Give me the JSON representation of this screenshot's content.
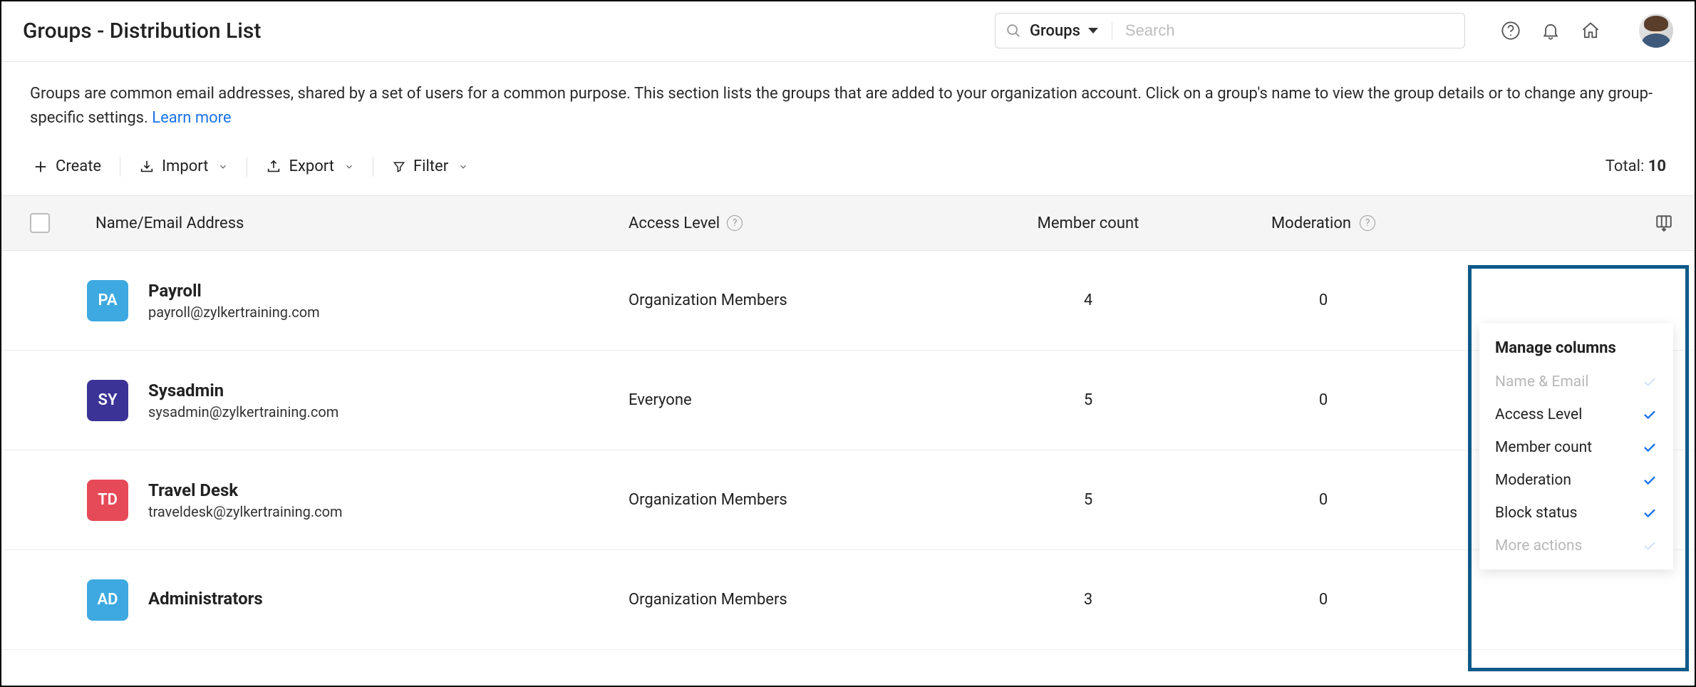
{
  "header": {
    "title": "Groups - Distribution List",
    "search_scope": "Groups",
    "search_placeholder": "Search"
  },
  "intro": {
    "text": "Groups are common email addresses, shared by a set of users for a common purpose. This section lists the groups that are added to your organization account. Click on a group's name to view the group details or to change any group-specific settings.  ",
    "learn_more": "Learn more"
  },
  "toolbar": {
    "create": "Create",
    "import": "Import",
    "export": "Export",
    "filter": "Filter",
    "total_label": "Total: ",
    "total_value": "10"
  },
  "columns": {
    "name": "Name/Email Address",
    "access": "Access Level",
    "member": "Member count",
    "moderation": "Moderation"
  },
  "rows": [
    {
      "initials": "PA",
      "color": "#3ea9e0",
      "name": "Payroll",
      "email": "payroll@zylkertraining.com",
      "access": "Organization Members",
      "members": "4",
      "moderation": "0"
    },
    {
      "initials": "SY",
      "color": "#3b3396",
      "name": "Sysadmin",
      "email": "sysadmin@zylkertraining.com",
      "access": "Everyone",
      "members": "5",
      "moderation": "0"
    },
    {
      "initials": "TD",
      "color": "#e64a58",
      "name": "Travel Desk",
      "email": "traveldesk@zylkertraining.com",
      "access": "Organization Members",
      "members": "5",
      "moderation": "0"
    },
    {
      "initials": "AD",
      "color": "#3ea9e0",
      "name": "Administrators",
      "email": "",
      "access": "Organization Members",
      "members": "3",
      "moderation": "0"
    }
  ],
  "popover": {
    "title": "Manage columns",
    "items": [
      {
        "label": "Name & Email",
        "checked": true,
        "disabled": true
      },
      {
        "label": "Access Level",
        "checked": true,
        "disabled": false
      },
      {
        "label": "Member count",
        "checked": true,
        "disabled": false
      },
      {
        "label": "Moderation",
        "checked": true,
        "disabled": false
      },
      {
        "label": "Block status",
        "checked": true,
        "disabled": false
      },
      {
        "label": "More actions",
        "checked": true,
        "disabled": true
      }
    ]
  }
}
